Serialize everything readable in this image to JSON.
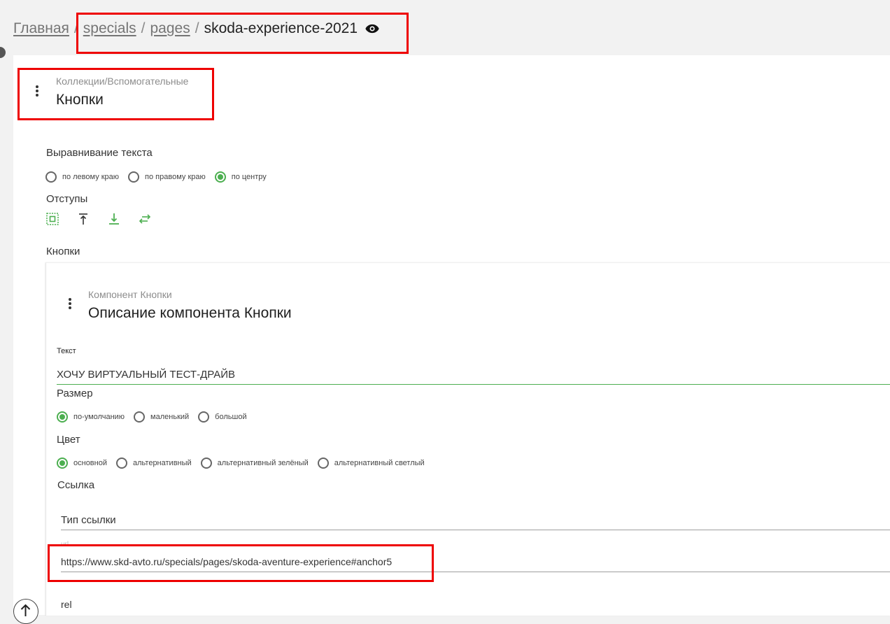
{
  "breadcrumb": {
    "home": "Главная",
    "specials": "specials",
    "pages": "pages",
    "current": "skoda-experience-2021",
    "separator": "/",
    "view_icon": "eye-icon"
  },
  "block": {
    "collection_path": "Коллекции/Вспомогательные",
    "title": "Кнопки",
    "menu_icon": "more-vert-icon"
  },
  "text_align": {
    "label": "Выравнивание текста",
    "options": [
      "по левому краю",
      "по правому краю",
      "по центру"
    ],
    "selected": "по центру"
  },
  "padding": {
    "label": "Отступы",
    "icons": [
      "padding-all-icon",
      "align-top-icon",
      "arrow-to-bottom-icon",
      "swap-horizontal-icon"
    ]
  },
  "buttons_section": {
    "label": "Кнопки"
  },
  "component": {
    "subtitle": "Компонент Кнопки",
    "title": "Описание компонента Кнопки",
    "text_field": {
      "label": "Текст",
      "value": "ХОЧУ ВИРТУАЛЬНЫЙ ТЕСТ-ДРАЙВ"
    },
    "size": {
      "label": "Размер",
      "options": [
        "по-умолчанию",
        "маленький",
        "большой"
      ],
      "selected": "по-умолчанию"
    },
    "color": {
      "label": "Цвет",
      "options": [
        "основной",
        "альтернативный",
        "альтернативный зелёный",
        "альтернативный светлый"
      ],
      "selected": "основной"
    },
    "link": {
      "label": "Ссылка",
      "type_placeholder": "Тип ссылки",
      "url_label": "url",
      "url_value": "https://www.skd-avto.ru/specials/pages/skoda-aventure-experience#anchor5",
      "rel_label": "rel"
    }
  },
  "colors": {
    "accent": "#4caf50",
    "highlight": "#ee0000",
    "background": "#f2f2f2"
  }
}
